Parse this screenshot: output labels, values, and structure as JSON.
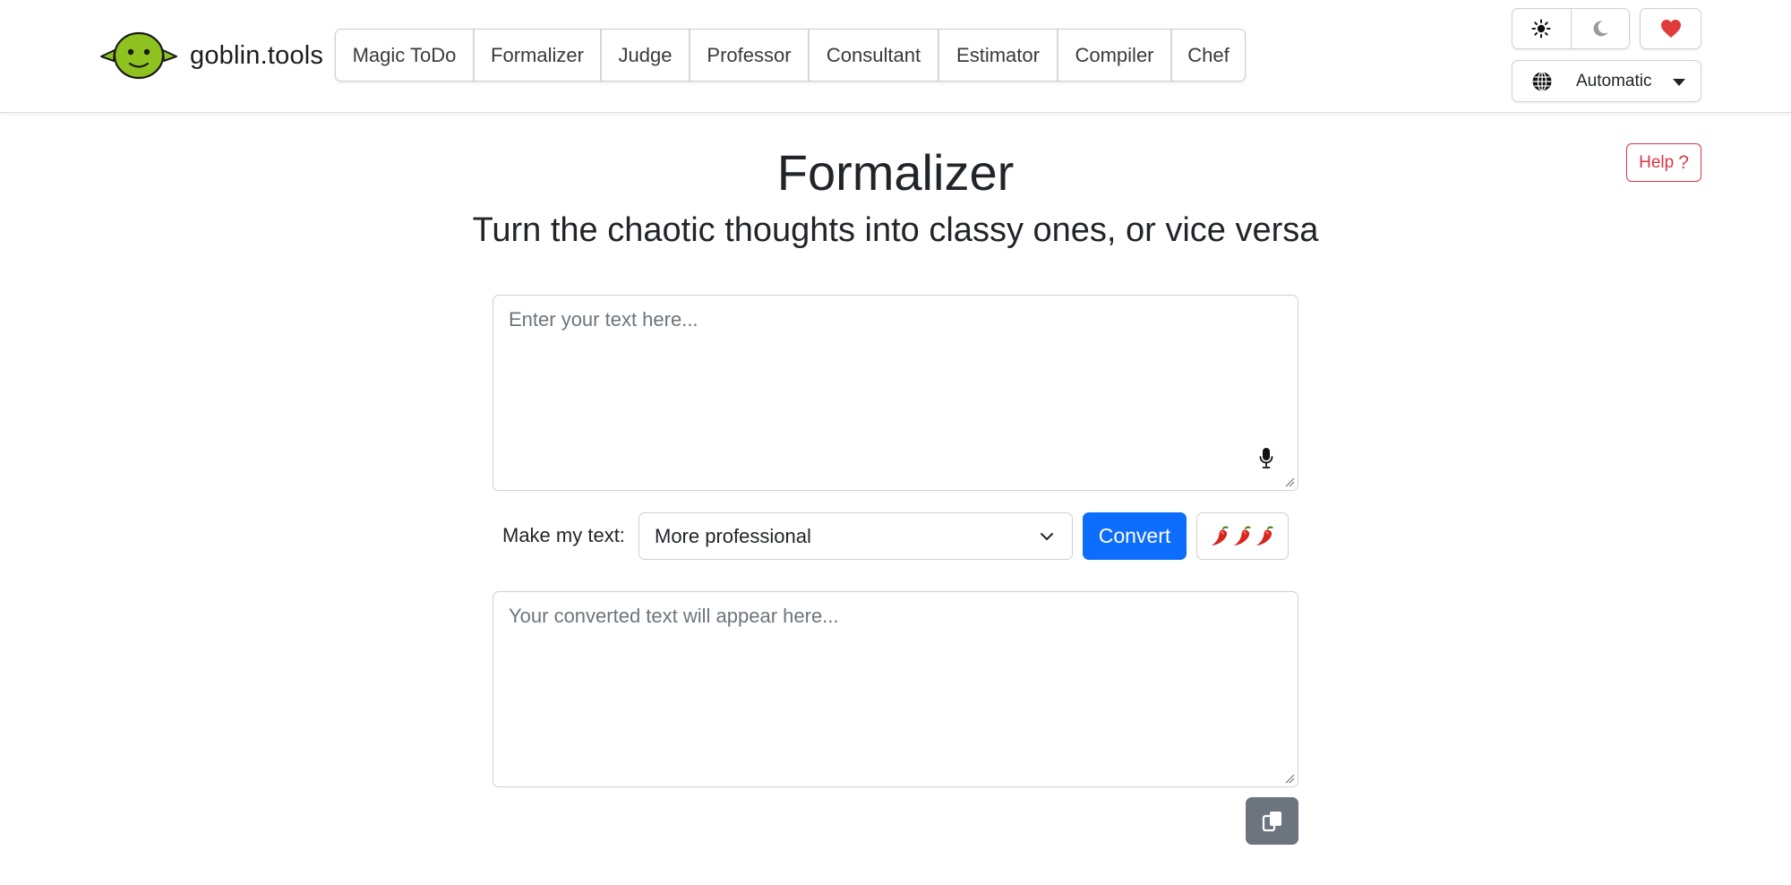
{
  "brand": {
    "name": "goblin.tools"
  },
  "nav": {
    "items": [
      {
        "label": "Magic ToDo"
      },
      {
        "label": "Formalizer"
      },
      {
        "label": "Judge"
      },
      {
        "label": "Professor"
      },
      {
        "label": "Consultant"
      },
      {
        "label": "Estimator"
      },
      {
        "label": "Compiler"
      },
      {
        "label": "Chef"
      }
    ]
  },
  "theme": {
    "light_icon": "sun-icon",
    "dark_icon": "moon-icon"
  },
  "support": {
    "icon": "heart-icon"
  },
  "language": {
    "icon": "globe-icon",
    "selected": "Automatic"
  },
  "help": {
    "label": "Help",
    "icon_glyph": "?"
  },
  "main": {
    "title": "Formalizer",
    "subtitle": "Turn the chaotic thoughts into classy ones, or vice versa",
    "input": {
      "placeholder": "Enter your text here...",
      "value": ""
    },
    "controls": {
      "label": "Make my text:",
      "mode_selected": "More professional",
      "convert_label": "Convert",
      "spiciness_icon": "chili-pepper-icon",
      "spiciness_level": 3
    },
    "output": {
      "placeholder": "Your converted text will appear here...",
      "value": ""
    },
    "copy_icon": "copy-icon"
  },
  "colors": {
    "primary": "#0d6efd",
    "danger": "#dc3545",
    "secondary": "#6c757d",
    "goblin_green": "#8dc21f",
    "heart": "#e03a3a"
  }
}
